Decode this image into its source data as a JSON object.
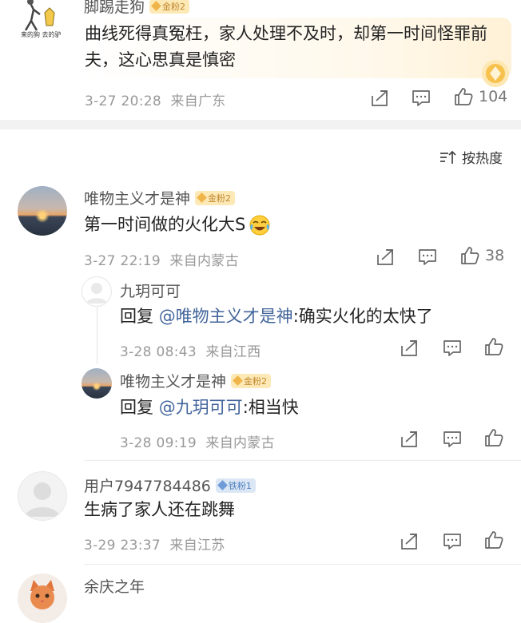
{
  "comment1": {
    "username": "脚踢走狗",
    "badge": "金粉2",
    "text": "曲线死得真冤枉，家人处理不及时，却第一时间怪罪前夫，这心思真是慎密",
    "time": "3-27 20:28",
    "location": "来自广东",
    "likes": "104",
    "avatar_caption": "来的狗  去的驴"
  },
  "sort": {
    "label": "按热度"
  },
  "comment2": {
    "username": "唯物主义才是神",
    "badge": "金粉2",
    "text": "第一时间做的火化大S",
    "time": "3-27 22:19",
    "location": "来自内蒙古",
    "likes": "38",
    "replies": [
      {
        "username": "九玥可可",
        "reply_prefix": "回复",
        "mention": "@唯物主义才是神",
        "text": ":确实火化的太快了",
        "time": "3-28 08:43",
        "location": "来自江西"
      },
      {
        "username": "唯物主义才是神",
        "badge": "金粉2",
        "reply_prefix": "回复",
        "mention": "@九玥可可",
        "text": ":相当快",
        "time": "3-28 09:19",
        "location": "来自内蒙古"
      }
    ]
  },
  "comment3": {
    "username": "用户7947784486",
    "badge": "铁粉1",
    "text": "生病了家人还在跳舞",
    "time": "3-29 23:37",
    "location": "来自江苏"
  },
  "comment4": {
    "username": "余庆之年"
  },
  "icons": {
    "share": "share-icon",
    "comment": "comment-icon",
    "like": "like-icon",
    "sort": "sort-icon",
    "emoji": "laughing-tears-emoji"
  },
  "colors": {
    "mention": "#41649b",
    "badge_gold": "#fde9b6",
    "badge_iron": "#dbe7f5"
  }
}
